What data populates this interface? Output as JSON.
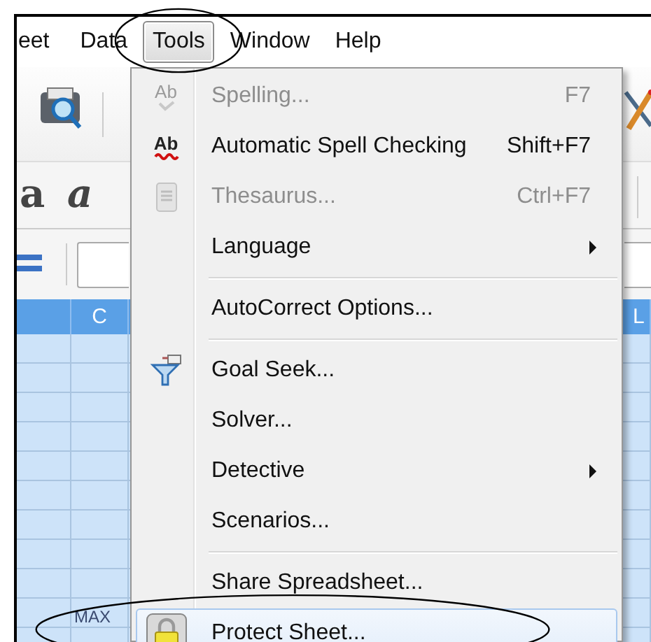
{
  "menu_bar": [
    {
      "label": "eet",
      "selected": false,
      "circled": false
    },
    {
      "label": "Data",
      "selected": false,
      "circled": false
    },
    {
      "label": "Tools",
      "selected": true,
      "circled": true
    },
    {
      "label": "Window",
      "selected": false,
      "circled": false
    },
    {
      "label": "Help",
      "selected": false,
      "circled": false
    }
  ],
  "format_buttons": [
    {
      "label": "a",
      "kind": "bold"
    },
    {
      "label": "a",
      "kind": "italic"
    }
  ],
  "sheet": {
    "columns": [
      "C",
      "L"
    ],
    "cells": [
      "MAX"
    ]
  },
  "tools_menu": {
    "items": [
      {
        "kind": "item",
        "icon_text": "Ab",
        "label": "Spelling...",
        "shortcut": "F7",
        "disabled": true,
        "submenu": false,
        "selected": false,
        "circled": false
      },
      {
        "kind": "item",
        "icon_text": "Ab",
        "label": "Automatic Spell Checking",
        "shortcut": "Shift+F7",
        "disabled": false,
        "submenu": false,
        "selected": false,
        "circled": false
      },
      {
        "kind": "item",
        "label": "Thesaurus...",
        "shortcut": "Ctrl+F7",
        "disabled": true,
        "submenu": false,
        "selected": false,
        "circled": false
      },
      {
        "kind": "item",
        "label": "Language",
        "disabled": false,
        "submenu": true,
        "selected": false,
        "circled": false
      },
      {
        "kind": "separator"
      },
      {
        "kind": "item",
        "label": "AutoCorrect Options...",
        "disabled": false,
        "submenu": false,
        "selected": false,
        "circled": false
      },
      {
        "kind": "separator"
      },
      {
        "kind": "item",
        "label": "Goal Seek...",
        "disabled": false,
        "submenu": false,
        "selected": false,
        "circled": false
      },
      {
        "kind": "item",
        "label": "Solver...",
        "disabled": false,
        "submenu": false,
        "selected": false,
        "circled": false
      },
      {
        "kind": "item",
        "label": "Detective",
        "disabled": false,
        "submenu": true,
        "selected": false,
        "circled": false
      },
      {
        "kind": "item",
        "label": "Scenarios...",
        "disabled": false,
        "submenu": false,
        "selected": false,
        "circled": false
      },
      {
        "kind": "separator"
      },
      {
        "kind": "item",
        "label": "Share Spreadsheet...",
        "disabled": false,
        "submenu": false,
        "selected": false,
        "circled": false
      },
      {
        "kind": "item",
        "label": "Protect Sheet...",
        "disabled": false,
        "submenu": false,
        "selected": true,
        "circled": true
      }
    ]
  }
}
